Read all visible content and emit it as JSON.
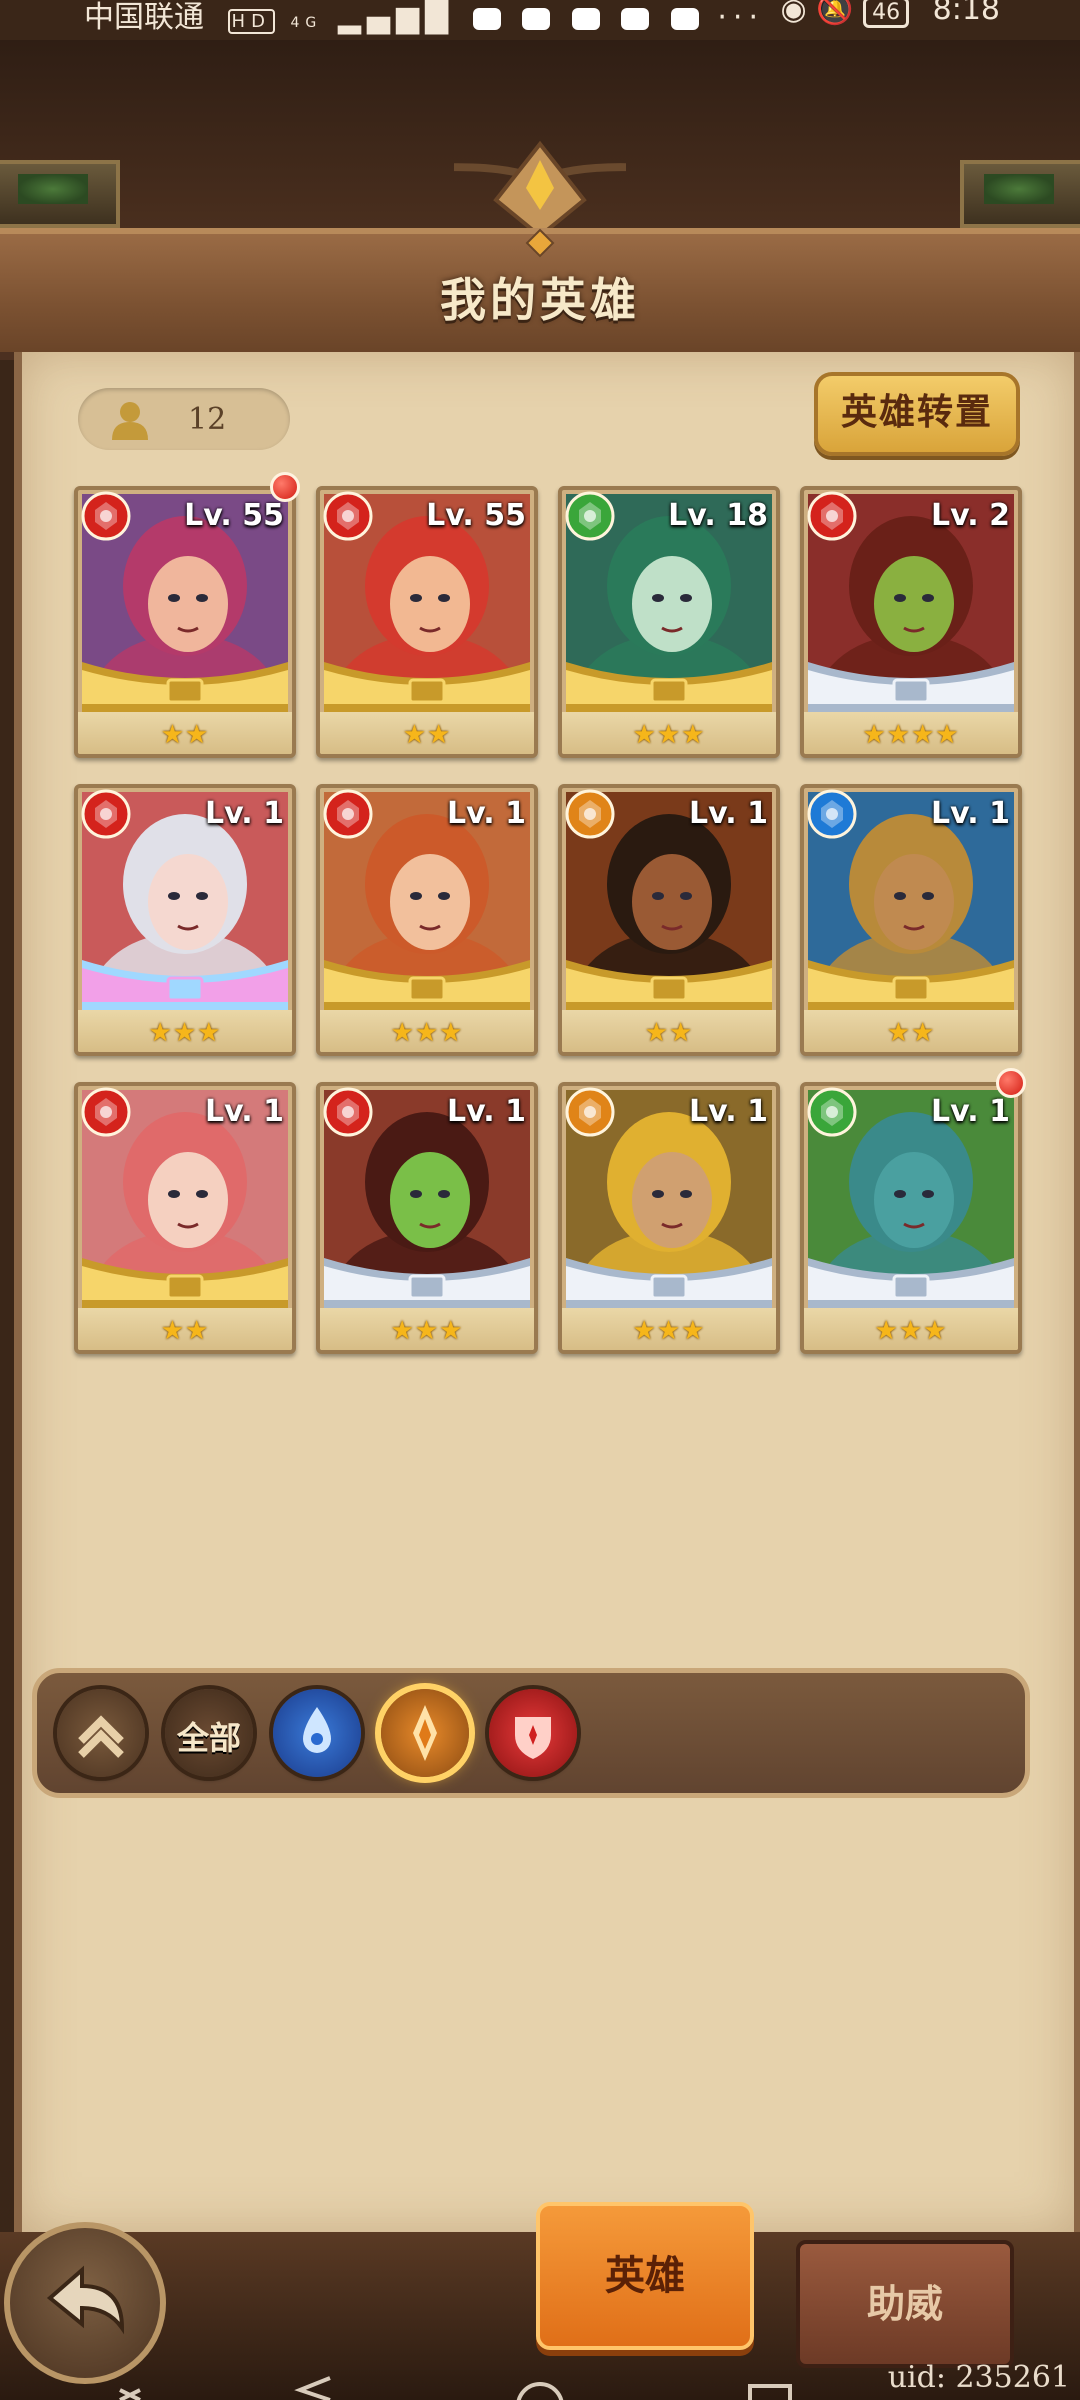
{
  "status_bar": {
    "carrier": "中国联通",
    "hd": "HD",
    "signal": "4G",
    "battery": "46",
    "time": "8:18"
  },
  "header": {
    "title": "我的英雄"
  },
  "hero_count": "12",
  "transfer_button": "英雄转置",
  "heroes": [
    {
      "level": "Lv. 55",
      "element": "fire",
      "stars": "★★",
      "new": true,
      "bg": "#7a4a86",
      "hair": "#b43a6a",
      "skin": "#f0b69c",
      "frame": "gold"
    },
    {
      "level": "Lv. 55",
      "element": "fire",
      "stars": "★★",
      "new": false,
      "bg": "#b8503a",
      "hair": "#d43a2e",
      "skin": "#f2b892",
      "frame": "gold"
    },
    {
      "level": "Lv. 18",
      "element": "nature",
      "stars": "★★★",
      "new": false,
      "bg": "#2f6a58",
      "hair": "#2a7a5a",
      "skin": "#bfe0c8",
      "frame": "gold"
    },
    {
      "level": "Lv. 2",
      "element": "fire",
      "stars": "★★★★",
      "new": false,
      "bg": "#8a2e2a",
      "hair": "#6a2018",
      "skin": "#8ab040",
      "frame": "silver"
    },
    {
      "level": "Lv. 1",
      "element": "fire",
      "stars": "★★★",
      "new": false,
      "bg": "#c95a5a",
      "hair": "#e0e0e8",
      "skin": "#f5d8d0",
      "frame": "rainbow"
    },
    {
      "level": "Lv. 1",
      "element": "fire",
      "stars": "★★★",
      "new": false,
      "bg": "#c26a3a",
      "hair": "#cc5a2a",
      "skin": "#f2c09c",
      "frame": "gold"
    },
    {
      "level": "Lv. 1",
      "element": "earth",
      "stars": "★★",
      "new": false,
      "bg": "#7a3a1a",
      "hair": "#2a1a10",
      "skin": "#9a5a34",
      "frame": "gold"
    },
    {
      "level": "Lv. 1",
      "element": "water",
      "stars": "★★",
      "new": false,
      "bg": "#2e6a9a",
      "hair": "#b88a3a",
      "skin": "#c08a50",
      "frame": "gold"
    },
    {
      "level": "Lv. 1",
      "element": "fire",
      "stars": "★★",
      "new": false,
      "bg": "#d47a7a",
      "hair": "#e06a6a",
      "skin": "#f5d0c0",
      "frame": "gold"
    },
    {
      "level": "Lv. 1",
      "element": "fire",
      "stars": "★★★",
      "new": false,
      "bg": "#8a3a2a",
      "hair": "#4a1a14",
      "skin": "#7abf48",
      "frame": "silver"
    },
    {
      "level": "Lv. 1",
      "element": "earth",
      "stars": "★★★",
      "new": false,
      "bg": "#8a6a2a",
      "hair": "#e0b030",
      "skin": "#d0a070",
      "frame": "silver"
    },
    {
      "level": "Lv. 1",
      "element": "nature",
      "stars": "★★★",
      "new": true,
      "bg": "#4a8a3a",
      "hair": "#3a8a8a",
      "skin": "#4aa0a0",
      "frame": "silver"
    }
  ],
  "element_colors": {
    "fire": "#d4231c",
    "nature": "#3aa63a",
    "earth": "#e08418",
    "water": "#1e7ad6"
  },
  "filters": [
    {
      "name": "rank-up-icon",
      "label": ""
    },
    {
      "name": "all",
      "label": "全部"
    },
    {
      "name": "water-icon",
      "label": ""
    },
    {
      "name": "earth-icon",
      "label": ""
    },
    {
      "name": "fire-icon",
      "label": ""
    }
  ],
  "tabs": {
    "hero": "英雄",
    "assist": "助威"
  },
  "uid": "uid: 235261"
}
